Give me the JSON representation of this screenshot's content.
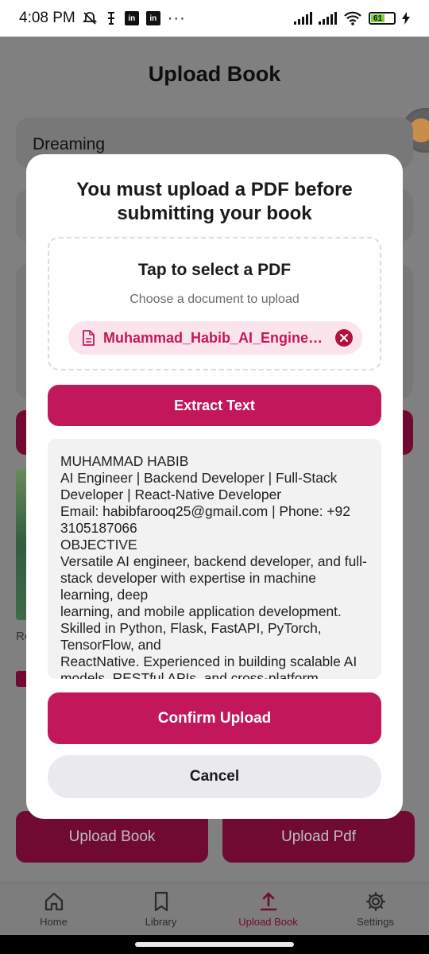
{
  "status_bar": {
    "time": "4:08 PM",
    "battery": "61",
    "icons": [
      "mute-icon",
      "alarm-icon",
      "linkedin-icon",
      "linkedin-icon",
      "more-dots-icon",
      "signal-icon",
      "signal-icon",
      "wifi-icon",
      "battery-icon",
      "charging-icon"
    ]
  },
  "page": {
    "title": "Upload Book",
    "title_input_value": "Dreaming",
    "partial_label": "Re",
    "upload_book_button": "Upload Book",
    "upload_pdf_button": "Upload Pdf"
  },
  "modal": {
    "title": "You must upload a PDF before submitting your book",
    "dropzone_title": "Tap to select a PDF",
    "dropzone_subtitle": "Choose a document to upload",
    "file_name": "Muhammad_Habib_AI_Engineer.pdf",
    "extract_button": "Extract Text",
    "extracted_text": "MUHAMMAD HABIB\nAI Engineer | Backend Developer | Full-Stack Developer | React-Native Developer\nEmail: habibfarooq25@gmail.com | Phone: +92 3105187066\nOBJECTIVE\nVersatile AI engineer, backend developer, and full-stack developer with expertise in machine learning, deep\nlearning, and mobile application development. Skilled in Python, Flask, FastAPI, PyTorch, TensorFlow, and\nReactNative. Experienced in building scalable AI models, RESTful APIs, and cross-platform",
    "confirm_button": "Confirm Upload",
    "cancel_button": "Cancel"
  },
  "bottom_nav": {
    "items": [
      {
        "label": "Home",
        "icon": "home-icon",
        "active": false
      },
      {
        "label": "Library",
        "icon": "bookmark-icon",
        "active": false
      },
      {
        "label": "Upload Book",
        "icon": "upload-icon",
        "active": true
      },
      {
        "label": "Settings",
        "icon": "gear-icon",
        "active": false
      }
    ]
  },
  "colors": {
    "accent": "#c2185b",
    "accent_dim": "#700a33",
    "chip_bg": "#fbe4ec",
    "overlay": "#808080"
  }
}
